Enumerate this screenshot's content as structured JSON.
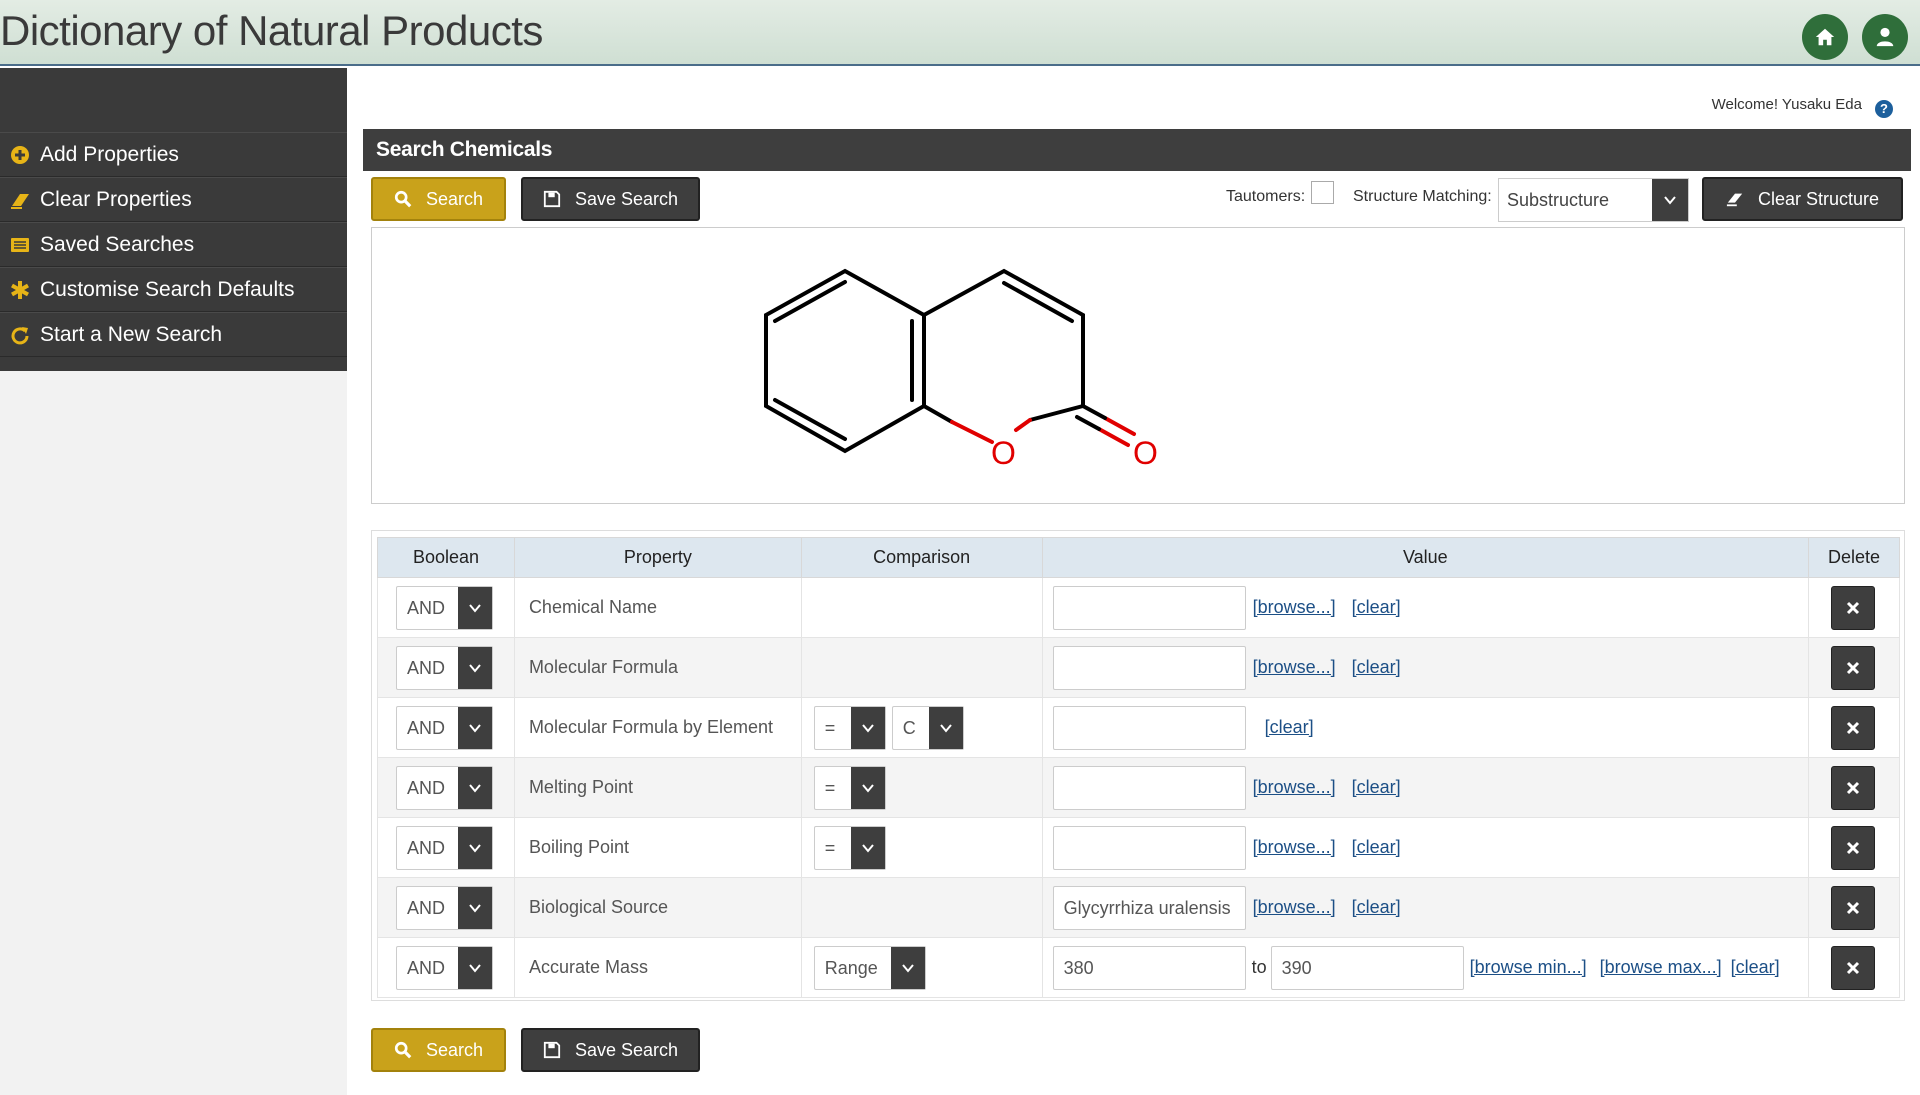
{
  "header": {
    "title": "Dictionary of Natural Products",
    "home_icon": "home-icon",
    "user_icon": "user-icon"
  },
  "sidebar": {
    "items": [
      {
        "label": "Add Properties",
        "icon": "plus-circle-icon"
      },
      {
        "label": "Clear Properties",
        "icon": "eraser-icon"
      },
      {
        "label": "Saved Searches",
        "icon": "list-icon"
      },
      {
        "label": "Customise Search Defaults",
        "icon": "asterisk-icon"
      },
      {
        "label": "Start a New Search",
        "icon": "refresh-icon"
      }
    ]
  },
  "user": {
    "welcome": "Welcome! Yusaku Eda"
  },
  "panel": {
    "title": "Search Chemicals"
  },
  "toolbar": {
    "search_label": "Search",
    "save_label": "Save Search",
    "tautomers_label": "Tautomers:",
    "tautomers_checked": false,
    "matching_label": "Structure Matching:",
    "matching_value": "Substructure",
    "clear_structure_label": "Clear Structure"
  },
  "structure": {
    "atom_labels": [
      "O",
      "O"
    ]
  },
  "table": {
    "headers": [
      "Boolean",
      "Property",
      "Comparison",
      "Value",
      "Delete"
    ],
    "rows": [
      {
        "boolean": "AND",
        "property": "Chemical Name",
        "value": "",
        "browse": "[browse...]",
        "clear": "[clear]"
      },
      {
        "boolean": "AND",
        "property": "Molecular Formula",
        "value": "",
        "browse": "[browse...]",
        "clear": "[clear]"
      },
      {
        "boolean": "AND",
        "property": "Molecular Formula by Element",
        "comparison": "=",
        "element": "C",
        "value": "",
        "clear": "[clear]"
      },
      {
        "boolean": "AND",
        "property": "Melting Point",
        "comparison": "=",
        "value": "",
        "browse": "[browse...]",
        "clear": "[clear]"
      },
      {
        "boolean": "AND",
        "property": "Boiling Point",
        "comparison": "=",
        "value": "",
        "browse": "[browse...]",
        "clear": "[clear]"
      },
      {
        "boolean": "AND",
        "property": "Biological Source",
        "value": "Glycyrrhiza uralensis",
        "browse": "[browse...]",
        "clear": "[clear]"
      },
      {
        "boolean": "AND",
        "property": "Accurate Mass",
        "comparison": "Range",
        "value": "380",
        "to_label": "to",
        "value2": "390",
        "browse_min": "[browse min...]",
        "browse_max": "[browse max...]",
        "clear": "[clear]"
      }
    ]
  },
  "colors": {
    "accent_yellow": "#c9a21b",
    "dark": "#3e3e3e",
    "header_green": "#2f6e3a",
    "link_blue": "#1c4f86",
    "heteroatom_red": "#e00000"
  }
}
